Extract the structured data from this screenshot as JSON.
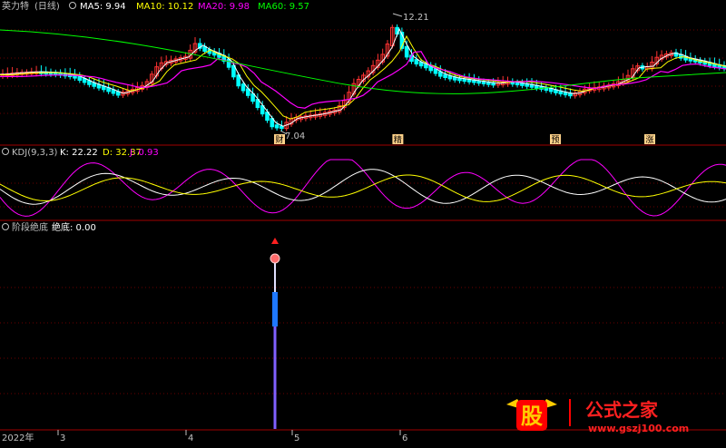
{
  "price_panel": {
    "stock_name": "英力特",
    "period": "(日线)",
    "legend": [
      {
        "label": "MA5: 9.94",
        "color": "#ffffff"
      },
      {
        "label": "MA10: 10.12",
        "color": "#ffff00"
      },
      {
        "label": "MA20: 9.98",
        "color": "#ff00ff"
      },
      {
        "label": "MA60: 9.57",
        "color": "#00ff00"
      }
    ],
    "high_marker": "12.21",
    "low_marker": "7.04",
    "signal_tags": [
      {
        "text": "财",
        "x": 0.385
      },
      {
        "text": "精",
        "x": 0.548
      },
      {
        "text": "预",
        "x": 0.765
      },
      {
        "text": "涨",
        "x": 0.895
      }
    ]
  },
  "kdj_panel": {
    "name": "KDJ(9,3,3)",
    "k_label": "K: 22.22",
    "d_label": "D: 32.87",
    "j_label": "J: 0.93"
  },
  "bottom_panel": {
    "name": "阶段绝底",
    "value_label": "绝底: 0.00"
  },
  "date_axis": {
    "year_label": "2022年",
    "month_ticks": [
      "3",
      "4",
      "5",
      "6"
    ]
  },
  "watermark": {
    "logo_char": "股",
    "title": "公式之家",
    "url": "www.gszj100.com"
  },
  "colors": {
    "up": "#ff3232",
    "down": "#00ffff",
    "grid": "#7a0000",
    "ma5": "#ffffff",
    "ma10": "#ffff00",
    "ma20": "#ff00ff",
    "ma60": "#00ff00"
  }
}
